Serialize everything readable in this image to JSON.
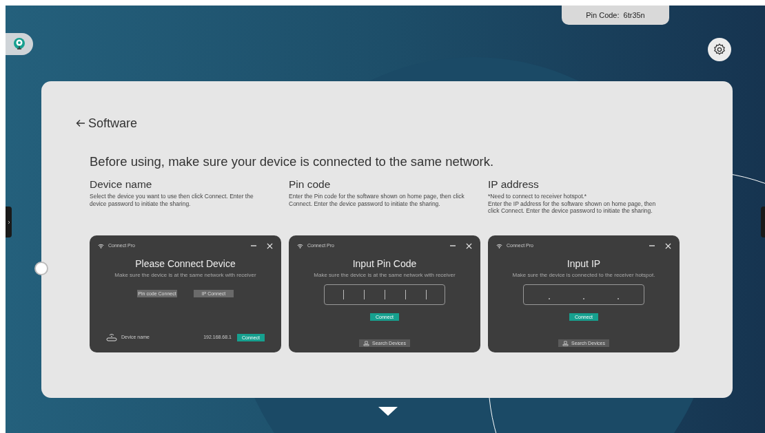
{
  "pin_code_badge": {
    "label": "Pin Code:",
    "value": "6tr35n"
  },
  "card": {
    "back_label": "Software",
    "heading": "Before using, make sure your device is connected to the same network.",
    "sections": [
      {
        "title": "Device name",
        "description": [
          "Select the device you want to use then click Connect. Enter the device password to initiate the sharing."
        ],
        "window": {
          "kind": "device",
          "app_name": "Connect Pro",
          "title": "Please Connect Device",
          "subtitle": "Make sure the device is at the same network with receiver",
          "mode_buttons": [
            "Pin code Connect",
            "IP Connect"
          ],
          "device_label": "Device name",
          "device_ip": "192.168.68.1",
          "connect_label": "Connect"
        }
      },
      {
        "title": "Pin code",
        "description": [
          "Enter the Pin code for the software shown on home page, then click Connect. Enter the device password to initiate the sharing."
        ],
        "window": {
          "kind": "pin",
          "app_name": "Connect Pro",
          "title": "Input Pin Code",
          "subtitle": "Make sure the device is at the same network with receiver",
          "connect_label": "Connect",
          "search_label": "Search Devices"
        }
      },
      {
        "title": "IP address",
        "description": [
          "*Need to connect to receiver hotspot.*",
          "Enter the IP address for the software shown on home page, then click Connect. Enter the device password to initiate the sharing."
        ],
        "window": {
          "kind": "ip",
          "app_name": "Connect Pro",
          "title": "Input IP",
          "subtitle": "Make sure the device is connected to the receiver hotspot.",
          "connect_label": "Connect",
          "search_label": "Search Devices"
        }
      }
    ]
  }
}
